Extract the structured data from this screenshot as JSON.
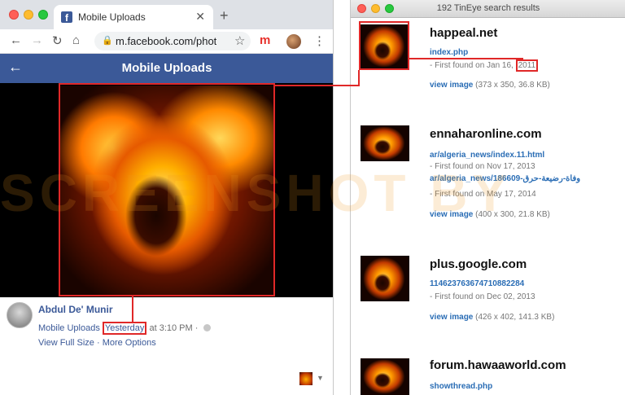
{
  "browser": {
    "tab_title": "Mobile Uploads",
    "tab_close": "✕",
    "new_tab": "+",
    "url": "m.facebook.com/photo...",
    "extension_label": "m"
  },
  "facebook": {
    "header_title": "Mobile Uploads",
    "author": "Abdul De' Munir",
    "album": "Mobile Uploads",
    "posted_day": "Yesterday",
    "posted_time": "at 3:10 PM ·",
    "view_full_size": "View Full Size",
    "more_options": "More Options",
    "separator": "·"
  },
  "tineye": {
    "window_title": "192 TinEye search results",
    "results": [
      {
        "domain": "happeal.net",
        "links": [
          "index.php"
        ],
        "found": [
          "- First found on Jan 16, "
        ],
        "found_year": "2011"
      },
      {
        "domain": "ennaharonline.com",
        "links": [
          "ar/algeria_news/index.11.html",
          "ar/algeria_news/186609-"
        ],
        "link2_arabic": "وفاة-رضيعة-حرق",
        "found": [
          "- First found on Nov 17, 2013",
          "- First found on May 17, 2014"
        ],
        "view_label": "view image",
        "view_details": "(400 x 300, 21.8 KB)"
      },
      {
        "domain": "plus.google.com",
        "links": [
          "114623763674710882284"
        ],
        "found": [
          "- First found on Dec 02, 2013"
        ],
        "view_label": "view image",
        "view_details": "(426 x 402, 141.3 KB)"
      },
      {
        "domain": "forum.hawaaworld.com",
        "links": [
          "showthread.php"
        ]
      }
    ],
    "first_view_label": "view image",
    "first_view_details": "(373 x 350, 36.8 KB)"
  },
  "colors": {
    "facebook_blue": "#3b5998",
    "highlight_red": "#e02828",
    "tineye_link": "#2a6db5"
  }
}
